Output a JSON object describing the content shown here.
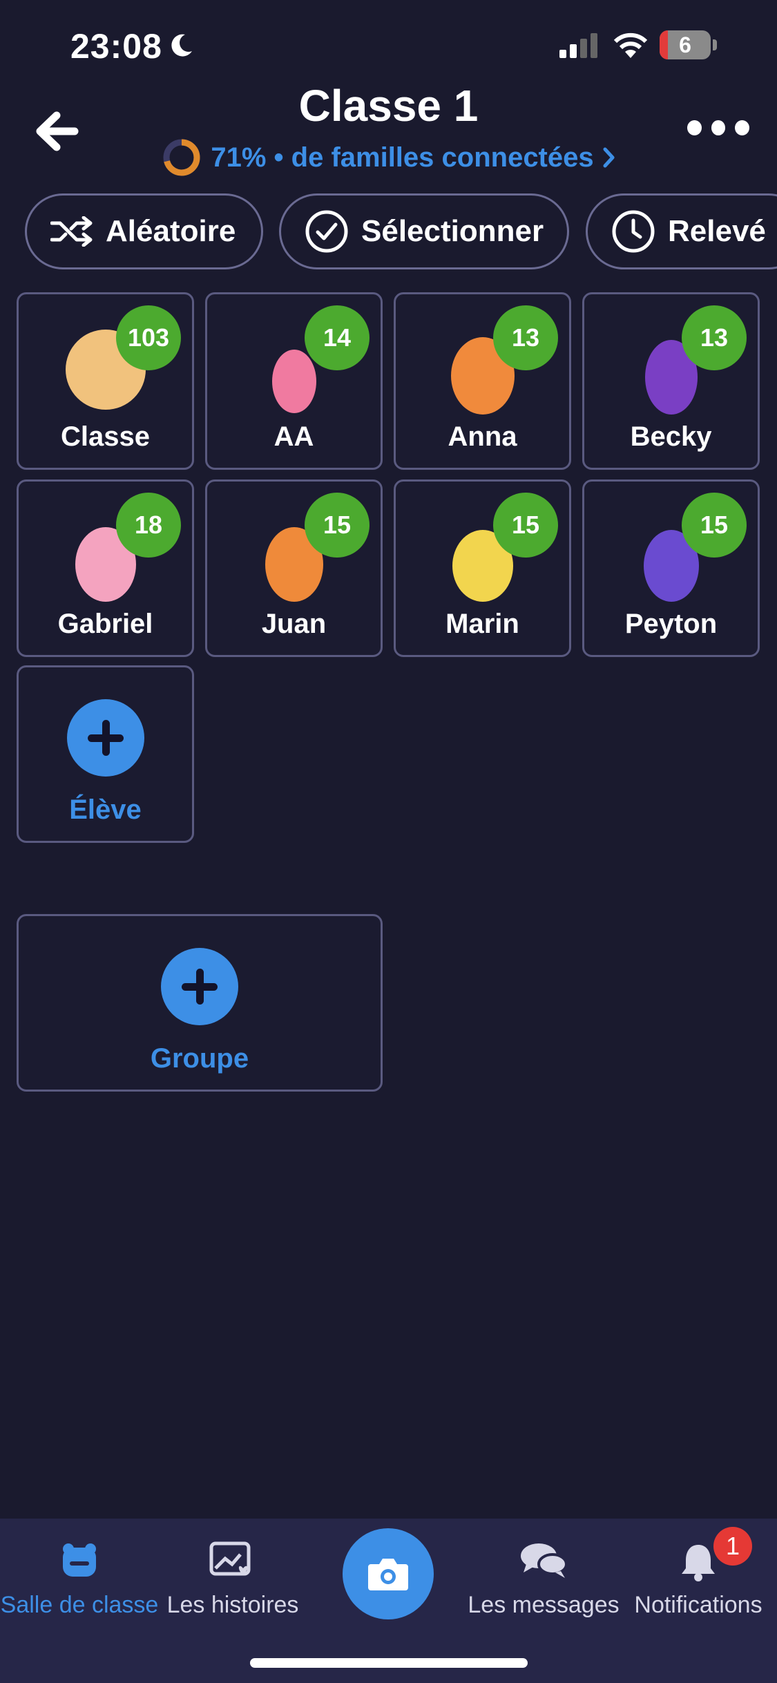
{
  "status_bar": {
    "time": "23:08",
    "battery": "6"
  },
  "header": {
    "title": "Classe 1",
    "connected_percent": 0.71,
    "subtitle": "71% • de familles connectées"
  },
  "toolbar": {
    "random_label": "Aléatoire",
    "select_label": "Sélectionner",
    "attendance_label": "Relevé"
  },
  "students": [
    {
      "name": "Classe",
      "points": "103",
      "avatar": "class-group-icon"
    },
    {
      "name": "AA",
      "points": "14",
      "avatar": "unicorn-monster-icon"
    },
    {
      "name": "Anna",
      "points": "13",
      "avatar": "orange-monster-icon"
    },
    {
      "name": "Becky",
      "points": "13",
      "avatar": "purple-cyclops-monster-icon"
    },
    {
      "name": "Gabriel",
      "points": "18",
      "avatar": "pink-monster-icon"
    },
    {
      "name": "Juan",
      "points": "15",
      "avatar": "orange-yellow-monster-icon"
    },
    {
      "name": "Marin",
      "points": "15",
      "avatar": "yellow-monster-icon"
    },
    {
      "name": "Peyton",
      "points": "15",
      "avatar": "blue-purple-monster-icon"
    }
  ],
  "add_student_label": "Élève",
  "add_group_label": "Groupe",
  "bottom_nav": {
    "classroom": "Salle de classe",
    "stories": "Les histoires",
    "messages": "Les messages",
    "notifications": "Notifications",
    "notifications_count": "1"
  },
  "colors": {
    "accent": "#3d8fe6",
    "points_badge": "#4caa2f",
    "background": "#1a1a2e"
  }
}
